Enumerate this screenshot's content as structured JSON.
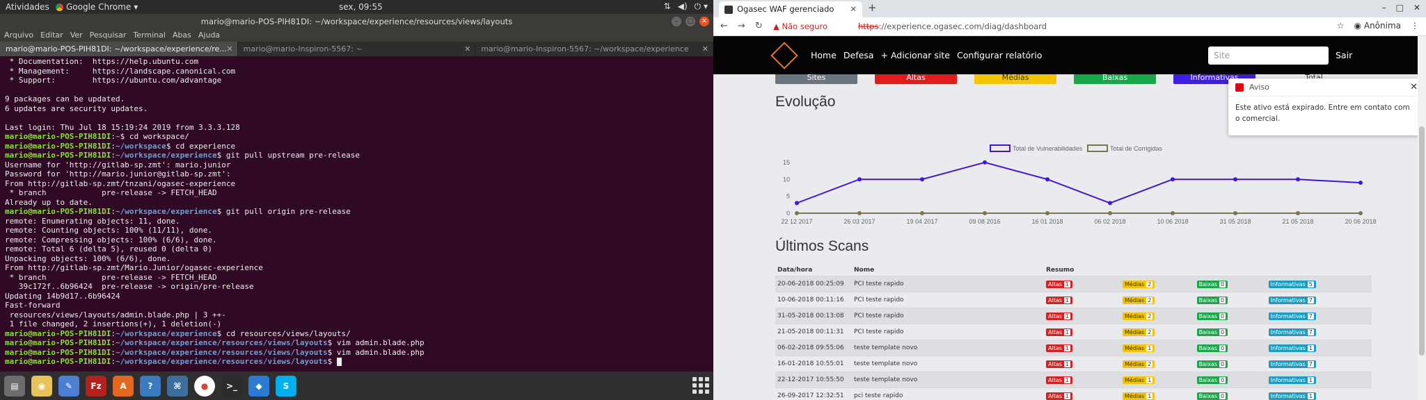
{
  "topbar": {
    "activities": "Atividades",
    "app": "Google Chrome",
    "clock": "sex, 09:55"
  },
  "terminal_window": {
    "title": "mario@mario-POS-PIH81DI: ~/workspace/experience/resources/views/layouts",
    "menu": [
      "Arquivo",
      "Editar",
      "Ver",
      "Pesquisar",
      "Terminal",
      "Abas",
      "Ajuda"
    ],
    "tabs": [
      {
        "label": "mario@mario-POS-PIH81DI: ~/workspace/experience/re...",
        "active": true
      },
      {
        "label": "mario@mario-Inspiron-5567: ~",
        "active": false
      },
      {
        "label": "mario@mario-Inspiron-5567: ~/workspace/experience",
        "active": false
      }
    ],
    "lines": [
      {
        "t": " * Documentation:  https://help.ubuntu.com"
      },
      {
        "t": " * Management:     https://landscape.canonical.com"
      },
      {
        "t": " * Support:        https://ubuntu.com/advantage"
      },
      {
        "t": ""
      },
      {
        "t": "9 packages can be updated."
      },
      {
        "t": "6 updates are security updates."
      },
      {
        "t": ""
      },
      {
        "t": "Last login: Thu Jul 18 15:19:24 2019 from 3.3.3.128"
      },
      {
        "u": "mario@mario-POS-PIH81DI",
        "p": "~",
        "c": "$ cd workspace/"
      },
      {
        "u": "mario@mario-POS-PIH81DI",
        "p": "~/workspace",
        "c": "$ cd experience"
      },
      {
        "u": "mario@mario-POS-PIH81DI",
        "p": "~/workspace/experience",
        "c": "$ git pull upstream pre-release"
      },
      {
        "t": "Username for 'http://gitlab-sp.zmt': mario.junior"
      },
      {
        "t": "Password for 'http://mario.junior@gitlab-sp.zmt':"
      },
      {
        "t": "From http://gitlab-sp.zmt/tnzani/ogasec-experience"
      },
      {
        "t": " * branch            pre-release -> FETCH_HEAD"
      },
      {
        "t": "Already up to date."
      },
      {
        "u": "mario@mario-POS-PIH81DI",
        "p": "~/workspace/experience",
        "c": "$ git pull origin pre-release"
      },
      {
        "t": "remote: Enumerating objects: 11, done."
      },
      {
        "t": "remote: Counting objects: 100% (11/11), done."
      },
      {
        "t": "remote: Compressing objects: 100% (6/6), done."
      },
      {
        "t": "remote: Total 6 (delta 5), reused 0 (delta 0)"
      },
      {
        "t": "Unpacking objects: 100% (6/6), done."
      },
      {
        "t": "From http://gitlab-sp.zmt/Mario.Junior/ogasec-experience"
      },
      {
        "t": " * branch            pre-release -> FETCH_HEAD"
      },
      {
        "t": "   39c172f..6b96424  pre-release -> origin/pre-release"
      },
      {
        "t": "Updating 14b9d17..6b96424"
      },
      {
        "t": "Fast-forward"
      },
      {
        "t": " resources/views/layouts/admin.blade.php | 3 ++-"
      },
      {
        "t": " 1 file changed, 2 insertions(+), 1 deletion(-)"
      },
      {
        "u": "mario@mario-POS-PIH81DI",
        "p": "~/workspace/experience",
        "c": "$ cd resources/views/layouts/"
      },
      {
        "u": "mario@mario-POS-PIH81DI",
        "p": "~/workspace/experience/resources/views/layouts",
        "c": "$ vim admin.blade.php"
      },
      {
        "u": "mario@mario-POS-PIH81DI",
        "p": "~/workspace/experience/resources/views/layouts",
        "c": "$ vim admin.blade.php"
      },
      {
        "u": "mario@mario-POS-PIH81DI",
        "p": "~/workspace/experience/resources/views/layouts",
        "c": "$ ",
        "cursor": true
      }
    ]
  },
  "dock": [
    {
      "icon": "files-icon",
      "color": "#6d6d6d",
      "glyph": "▤"
    },
    {
      "icon": "rhythmbox-icon",
      "color": "#e8c25a",
      "glyph": "◉"
    },
    {
      "icon": "text-editor-icon",
      "color": "#4c7ed1",
      "glyph": "✎"
    },
    {
      "icon": "filezilla-icon",
      "color": "#b2211e",
      "glyph": "Fz"
    },
    {
      "icon": "software-center-icon",
      "color": "#e5661f",
      "glyph": "A"
    },
    {
      "icon": "help-icon",
      "color": "#3b7bbf",
      "glyph": "?"
    },
    {
      "icon": "network-icon",
      "color": "#3d6e9e",
      "glyph": "⌘"
    },
    {
      "icon": "chrome-icon",
      "color": "#fff",
      "glyph": "●"
    },
    {
      "icon": "terminal-icon",
      "color": "#2c2c2c",
      "glyph": ">_"
    },
    {
      "icon": "vscode-icon",
      "color": "#2a7bd6",
      "glyph": "◆"
    },
    {
      "icon": "skype-icon",
      "color": "#00aff0",
      "glyph": "S"
    }
  ],
  "browser": {
    "tab_title": "Ogasec WAF gerenciado",
    "security": "Não seguro",
    "url_scheme": "https",
    "url_rest": "://experience.ogasec.com/diag/dashboard",
    "profile": "Anônima",
    "nav_links": [
      "Home",
      "Defesa",
      "+ Adicionar site",
      "Configurar relatório"
    ],
    "search_placeholder": "Site",
    "logout": "Sair",
    "stat_buttons": [
      {
        "label": "Sites",
        "color": "#6c757d"
      },
      {
        "label": "Altas",
        "color": "#e21c1c"
      },
      {
        "label": "Médias",
        "color": "#f5c400"
      },
      {
        "label": "Baixas",
        "color": "#19a74a"
      },
      {
        "label": "Informativas",
        "color": "#3c1ee6"
      },
      {
        "label": "Total",
        "color": "#ffffff"
      }
    ],
    "evolution_title": "Evolução",
    "scans_title": "Últimos Scans",
    "toast": {
      "title": "Aviso",
      "body": "Este ativo está expirado. Entre em contato com o comercial."
    },
    "table": {
      "headers": [
        "Data/hora",
        "Nome",
        "Resumo",
        "",
        "",
        ""
      ],
      "rows": [
        {
          "date": "20-06-2018 00:25:09",
          "name": "PCI teste rapido",
          "altas": "1",
          "medias": "2",
          "baixas": "0",
          "info": "5"
        },
        {
          "date": "10-06-2018 00:11:16",
          "name": "PCI teste rapido",
          "altas": "1",
          "medias": "2",
          "baixas": "0",
          "info": "7"
        },
        {
          "date": "31-05-2018 00:13:08",
          "name": "PCI teste rapido",
          "altas": "1",
          "medias": "2",
          "baixas": "0",
          "info": "7"
        },
        {
          "date": "21-05-2018 00:11:31",
          "name": "PCI teste rapido",
          "altas": "1",
          "medias": "2",
          "baixas": "0",
          "info": "7"
        },
        {
          "date": "06-02-2018 09:55:06",
          "name": "teste template novo",
          "altas": "1",
          "medias": "1",
          "baixas": "0",
          "info": "1"
        },
        {
          "date": "16-01-2018 10:55:01",
          "name": "teste template novo",
          "altas": "1",
          "medias": "2",
          "baixas": "0",
          "info": "7"
        },
        {
          "date": "22-12-2017 10:55:50",
          "name": "teste template novo",
          "altas": "1",
          "medias": "1",
          "baixas": "0",
          "info": "1"
        },
        {
          "date": "26-09-2017 12:32:51",
          "name": "pci teste rapido",
          "altas": "1",
          "medias": "1",
          "baixas": "0",
          "info": "1"
        }
      ]
    }
  },
  "chart_data": {
    "type": "line",
    "x": [
      "22 12 2017",
      "26 03 2017",
      "19 04 2017",
      "09 08 2016",
      "16 01 2018",
      "06 02 2018",
      "10 06 2018",
      "31 05 2018",
      "21 05 2018",
      "20 06 2018"
    ],
    "series": [
      {
        "name": "Total de Vulnerabilidades",
        "color": "#4412e0",
        "values": [
          3,
          10,
          10,
          15,
          10,
          3,
          10,
          10,
          10,
          9
        ]
      },
      {
        "name": "Total de Corrigidas",
        "color": "#7a7650",
        "values": [
          0,
          0,
          0,
          0,
          0,
          0,
          0,
          0,
          0,
          0
        ]
      }
    ],
    "yticks": [
      0,
      5,
      10,
      15
    ],
    "ylim": [
      0,
      16
    ],
    "legend": "top-center",
    "grid": false
  }
}
